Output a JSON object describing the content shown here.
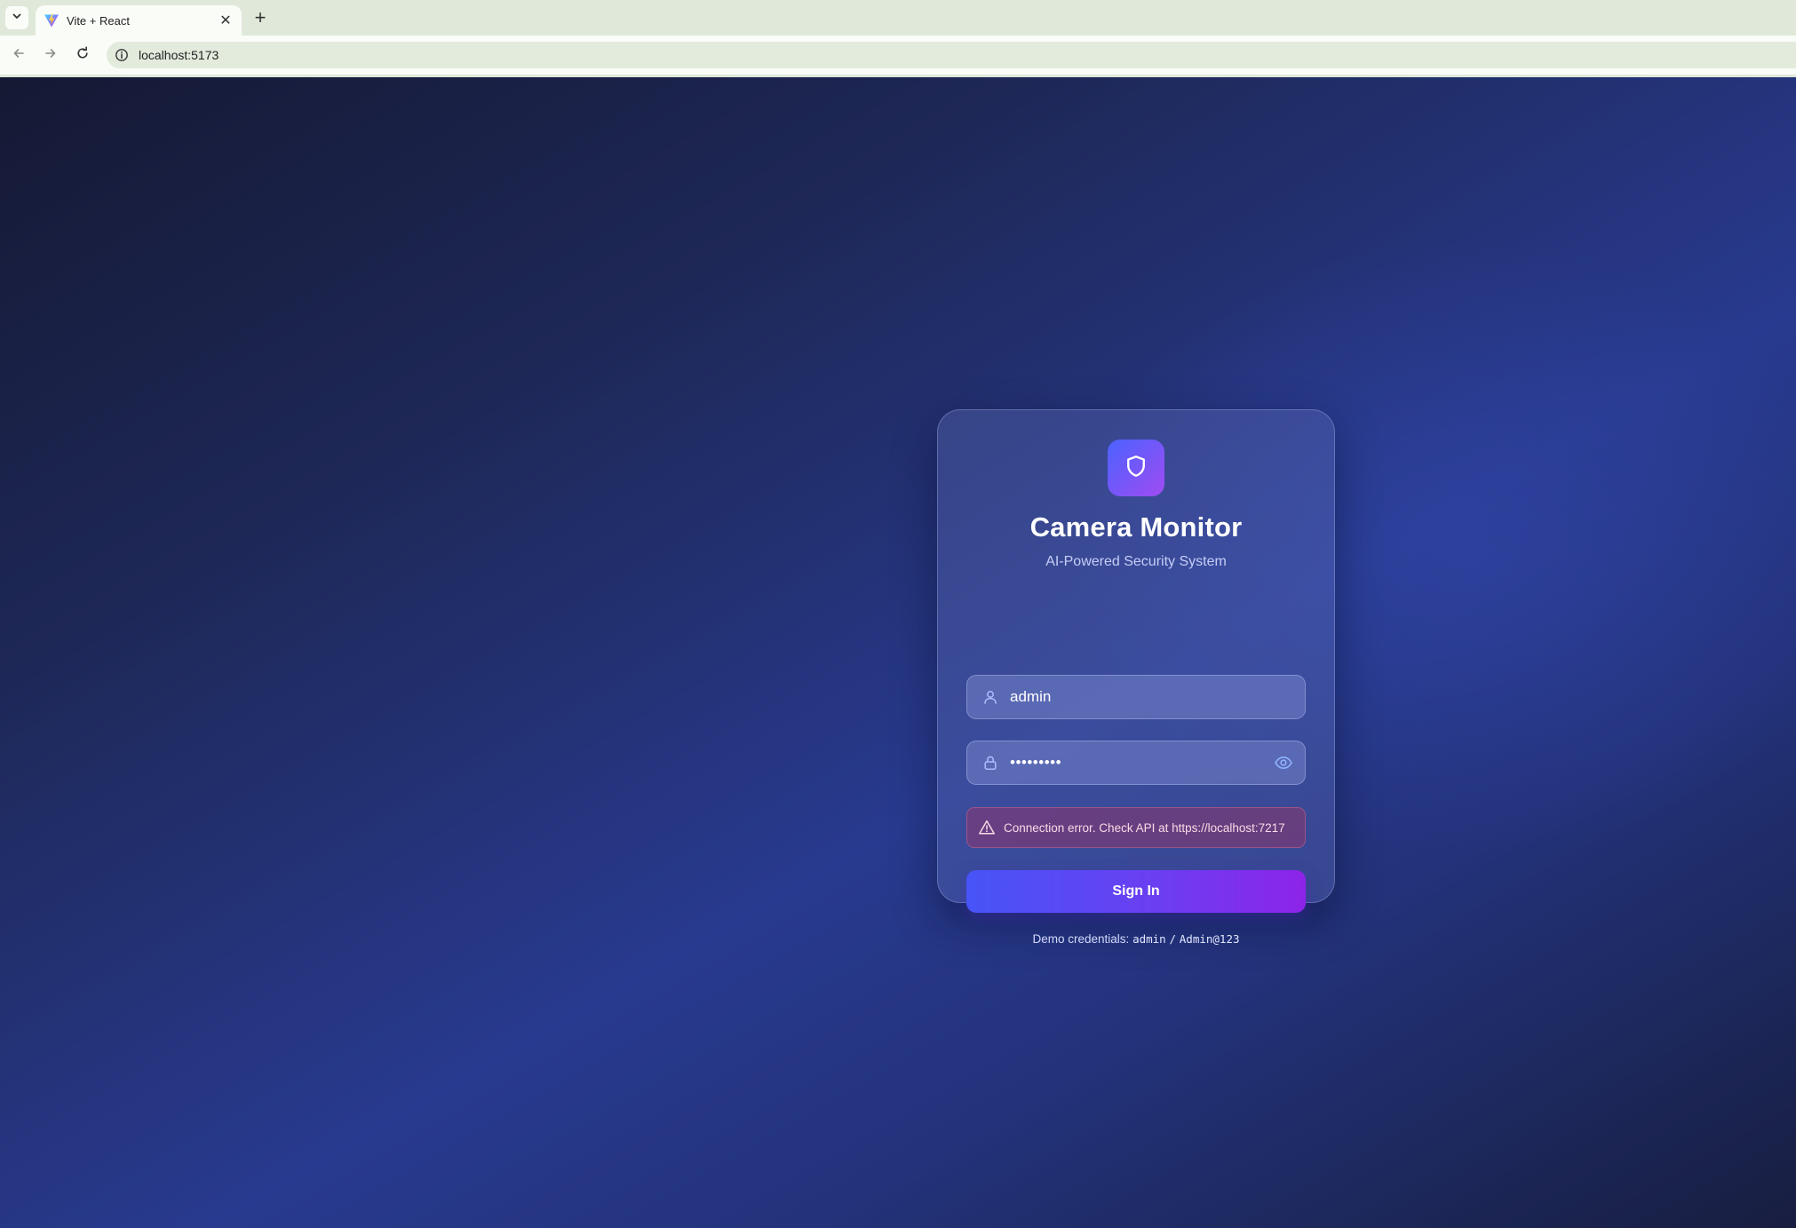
{
  "browser": {
    "tab": {
      "title": "Vite + React",
      "close_glyph": "✕"
    },
    "new_tab_glyph": "+",
    "url": "localhost:5173",
    "icons": {
      "tab_menu": "chevron-down-icon",
      "back": "arrow-left-icon",
      "forward": "arrow-right-icon",
      "reload": "reload-icon",
      "site_info": "info-icon"
    }
  },
  "login": {
    "logo_icon": "shield-icon",
    "title": "Camera Monitor",
    "subtitle": "AI-Powered Security System",
    "username": {
      "value": "admin",
      "icon": "user-icon"
    },
    "password": {
      "value": "•••••••••",
      "icon": "lock-icon",
      "toggle_icon": "eye-icon"
    },
    "error": {
      "icon": "warning-triangle-icon",
      "text": "Connection error. Check API at https://localhost:7217"
    },
    "submit_label": "Sign In",
    "demo": {
      "prefix": "Demo credentials:",
      "user": "admin",
      "separator": "/",
      "pass": "Admin@123"
    }
  },
  "colors": {
    "accent_start": "#4754f7",
    "accent_end": "#8d24e8",
    "logo_gradient_start": "#4a63ff",
    "logo_gradient_end": "#a04bf2",
    "error_text": "#fbd9e6"
  }
}
